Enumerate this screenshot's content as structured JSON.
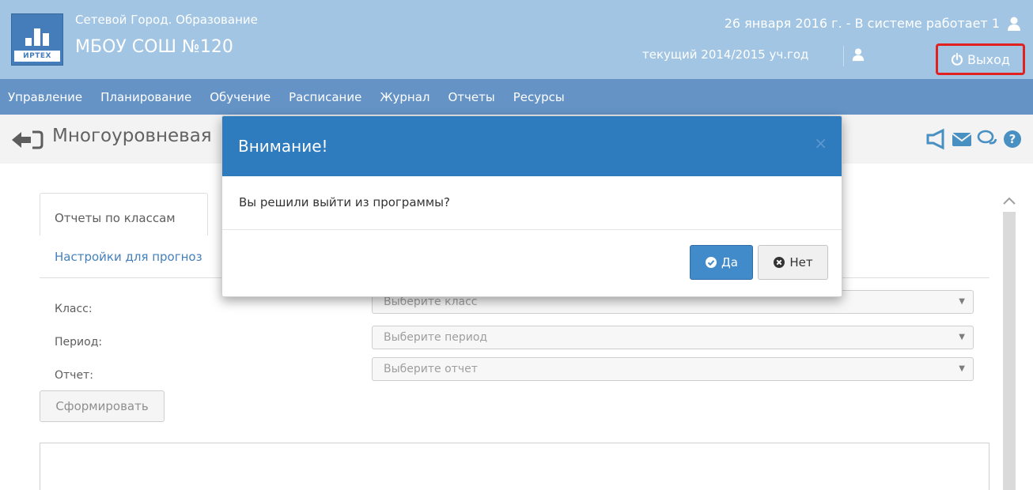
{
  "header": {
    "logo_text": "ИРТЕХ",
    "system_name": "Сетевой Город. Образование",
    "school_name": "МБОУ СОШ №120",
    "date_info": "26 января 2016 г. - В системе работает 1",
    "year_info": "текущий 2014/2015 уч.год",
    "logout_label": "Выход"
  },
  "nav": {
    "items": [
      {
        "label": "Управление"
      },
      {
        "label": "Планирование"
      },
      {
        "label": "Обучение"
      },
      {
        "label": "Расписание"
      },
      {
        "label": "Журнал"
      },
      {
        "label": "Отчеты"
      },
      {
        "label": "Ресурсы"
      }
    ]
  },
  "title_bar": {
    "title": "Многоуровневая"
  },
  "tabs": {
    "active": "Отчеты по классам",
    "second": "Настройки для прогноз"
  },
  "form": {
    "class_label": "Класс:",
    "class_placeholder": "Выберите класс",
    "period_label": "Период:",
    "period_placeholder": "Выберите период",
    "report_label": "Отчет:",
    "report_placeholder": "Выберите отчет",
    "generate_label": "Сформировать"
  },
  "modal": {
    "title": "Внимание!",
    "close": "×",
    "message": "Вы решили выйти из программы?",
    "yes_label": "Да",
    "no_label": "Нет"
  },
  "colors": {
    "header_bg": "#9cc2e2",
    "nav_bg": "#5d8ec3",
    "modal_header": "#2e7bbd",
    "primary_button": "#428bca",
    "highlight_border": "#e01515",
    "link": "#3a7ab8"
  }
}
